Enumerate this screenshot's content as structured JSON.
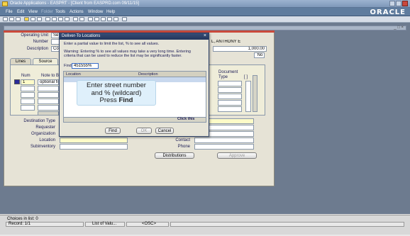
{
  "window": {
    "title": "Oracle Applications - EASPRT - [Client from EASPRD.com 09/11/15]"
  },
  "menu": {
    "items": [
      {
        "label": "File",
        "enabled": true
      },
      {
        "label": "Edit",
        "enabled": true
      },
      {
        "label": "View",
        "enabled": true
      },
      {
        "label": "Folder",
        "enabled": false
      },
      {
        "label": "Tools",
        "enabled": true
      },
      {
        "label": "Actions",
        "enabled": true
      },
      {
        "label": "Window",
        "enabled": true
      },
      {
        "label": "Help",
        "enabled": true
      }
    ],
    "brand": "ORACLE"
  },
  "subwindow": {
    "controls": "_ □ ×"
  },
  "form": {
    "operating_unit_label": "Operating Unit",
    "operating_unit_value": "Se",
    "number_label": "Number",
    "description_label": "Description",
    "description_value": "Co",
    "preparer_value": "L, ANTHONY E",
    "amount_value": "1,000.00",
    "flag_value": "No",
    "tabs": [
      "Lines",
      "Source"
    ],
    "num_header": "Num",
    "note_header": "Note to B",
    "row1_num": "1",
    "row1_note": "optional fi",
    "doc_type_header": "Document Type",
    "bracket_header": "[ ]",
    "destination_type_label": "Destination Type",
    "requester_label": "Requester",
    "organization_label": "Organization",
    "location_label": "Location",
    "subinventory_label": "Subinventory",
    "contact_label": "Contact",
    "phone_label": "Phone",
    "distributions_button": "Distributions",
    "approve_button": "Approve"
  },
  "dialog": {
    "title": "Deliver-To Locations",
    "instruction": "Enter a partial value to limit the list, % to see all values.",
    "warning_line1": "Warning: Entering % to see all values may take a very long time. Entering",
    "warning_line2": "criteria that can be used to reduce the list may be significantly faster.",
    "find_label": "Find",
    "find_value": "451555%",
    "col_location": "Location",
    "col_description": "Description",
    "tip_line1": "Enter street number",
    "tip_line2": "and % (wildcard)",
    "tip_line3_prefix": "Press ",
    "tip_line3_bold": "Find",
    "click_hint": "Click this",
    "find_button": "Find",
    "ok_button": "OK",
    "cancel_button": "Cancel"
  },
  "status": {
    "line1": "Choices in list: 0",
    "record": "Record: 1/1",
    "lov": "List of Valu...",
    "osc": "<OSC>"
  },
  "colors": {
    "title_bar": "#22365c",
    "menu_bar": "#5f7c9e",
    "form_bg": "#e6e3d6",
    "required_field": "#fdfbc8",
    "tip_bg": "#dff0fb"
  }
}
